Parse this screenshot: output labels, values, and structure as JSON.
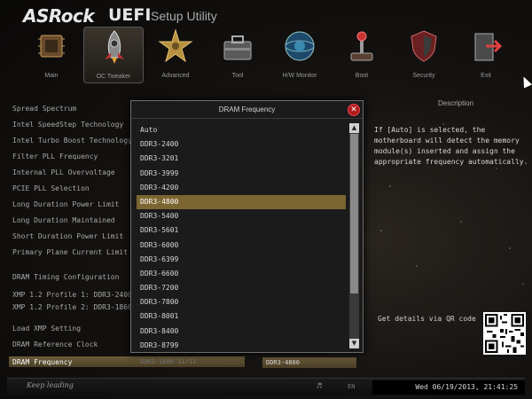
{
  "header": {
    "brand": "ASRock",
    "product": "UEFI",
    "subtitle": "Setup Utility"
  },
  "tabs": [
    {
      "label": "Main",
      "icon": "main-icon"
    },
    {
      "label": "OC Tweaker",
      "icon": "rocket-icon"
    },
    {
      "label": "Advanced",
      "icon": "star-icon"
    },
    {
      "label": "Tool",
      "icon": "toolbox-icon"
    },
    {
      "label": "H/W Monitor",
      "icon": "monitor-globe-icon"
    },
    {
      "label": "Boot",
      "icon": "joystick-icon"
    },
    {
      "label": "Security",
      "icon": "shield-icon"
    },
    {
      "label": "Exit",
      "icon": "exit-door-icon"
    }
  ],
  "active_tab": "OC Tweaker",
  "menu": {
    "items": [
      "Spread Spectrum",
      "Intel SpeedStep Technology",
      "Intel Turbo Boost Technology",
      "Filter PLL Frequency",
      "Internal PLL Overvoltage",
      "PCIE PLL Selection",
      "Long Duration Power Limit",
      "Long Duration Maintained",
      "Short Duration Power Limit",
      "Primary Plane Current Limit",
      "DRAM Timing Configuration",
      "XMP 1.2 Profile 1: DDR3-2400",
      "XMP 1.2 Profile 2: DDR3-1866",
      "Load XMP Setting",
      "DRAM Reference Clock",
      "DRAM Frequency"
    ],
    "selected_label": "DRAM Frequency",
    "selected_hint": "DDR3-1600 11/11",
    "selected_value": "DDR3-4800"
  },
  "description": {
    "title": "Description",
    "text": "If [Auto] is selected, the motherboard will detect the memory module(s) inserted and assign the appropriate frequency automatically.",
    "qr_label": "Get details via QR code"
  },
  "dialog": {
    "title": "DRAM Frequency",
    "options": [
      "Auto",
      "DDR3-2400",
      "DDR3-3201",
      "DDR3-3999",
      "DDR3-4200",
      "DDR3-4800",
      "DDR3-5400",
      "DDR3-5601",
      "DDR3-6000",
      "DDR3-6399",
      "DDR3-6600",
      "DDR3-7200",
      "DDR3-7800",
      "DDR3-8001",
      "DDR3-8400",
      "DDR3-8799"
    ],
    "selected_index": 5,
    "scroll_up": "▲",
    "scroll_down": "▼",
    "close_glyph": "✕"
  },
  "footer": {
    "signature": "Keep leading",
    "language": "EN",
    "datetime": "Wed 06/19/2013, 21:41:25"
  },
  "colors": {
    "accent": "#7b6531",
    "close": "#b01a1a"
  }
}
